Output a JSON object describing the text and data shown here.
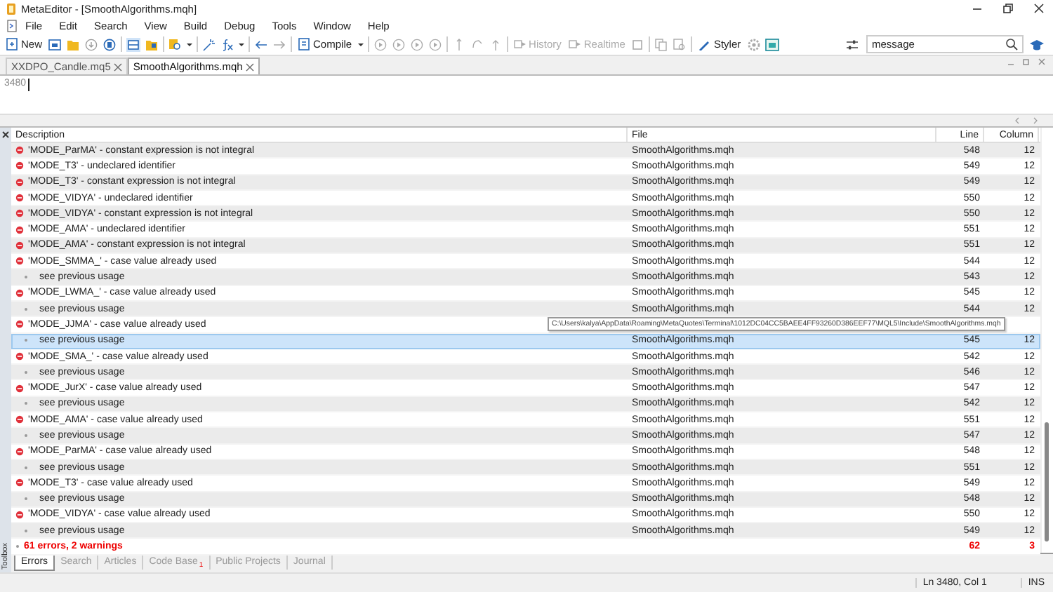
{
  "window": {
    "title": "MetaEditor - [SmoothAlgorithms.mqh]"
  },
  "menu": [
    "File",
    "Edit",
    "Search",
    "View",
    "Build",
    "Debug",
    "Tools",
    "Window",
    "Help"
  ],
  "toolbar": {
    "buttons": [
      {
        "label": "New",
        "disabled": false
      },
      {
        "label": "Compile",
        "disabled": false
      },
      {
        "label": "History",
        "disabled": true
      },
      {
        "label": "Realtime",
        "disabled": true
      },
      {
        "label": "Styler",
        "disabled": false
      }
    ],
    "search": {
      "value": "message"
    }
  },
  "tabs": [
    {
      "label": "XXDPO_Candle.mq5",
      "selected": false
    },
    {
      "label": "SmoothAlgorithms.mqh",
      "selected": true
    }
  ],
  "editor": {
    "line_number": "3480"
  },
  "errors_table": {
    "columns": [
      "Description",
      "File",
      "Line",
      "Column"
    ],
    "rows": [
      {
        "kind": "error",
        "description": "'MODE_ParMA' - constant expression is not integral",
        "file": "SmoothAlgorithms.mqh",
        "line": "548",
        "column": "12",
        "selected": false
      },
      {
        "kind": "error",
        "description": "'MODE_T3' - undeclared identifier",
        "file": "SmoothAlgorithms.mqh",
        "line": "549",
        "column": "12",
        "selected": false
      },
      {
        "kind": "error",
        "description": "'MODE_T3' - constant expression is not integral",
        "file": "SmoothAlgorithms.mqh",
        "line": "549",
        "column": "12",
        "selected": false
      },
      {
        "kind": "error",
        "description": "'MODE_VIDYA' - undeclared identifier",
        "file": "SmoothAlgorithms.mqh",
        "line": "550",
        "column": "12",
        "selected": false
      },
      {
        "kind": "error",
        "description": "'MODE_VIDYA' - constant expression is not integral",
        "file": "SmoothAlgorithms.mqh",
        "line": "550",
        "column": "12",
        "selected": false
      },
      {
        "kind": "error",
        "description": "'MODE_AMA' - undeclared identifier",
        "file": "SmoothAlgorithms.mqh",
        "line": "551",
        "column": "12",
        "selected": false
      },
      {
        "kind": "error",
        "description": "'MODE_AMA' - constant expression is not integral",
        "file": "SmoothAlgorithms.mqh",
        "line": "551",
        "column": "12",
        "selected": false
      },
      {
        "kind": "error",
        "description": "'MODE_SMMA_' - case value already used",
        "file": "SmoothAlgorithms.mqh",
        "line": "544",
        "column": "12",
        "selected": false
      },
      {
        "kind": "note",
        "description": "see previous usage",
        "file": "SmoothAlgorithms.mqh",
        "line": "543",
        "column": "12",
        "selected": false
      },
      {
        "kind": "error",
        "description": "'MODE_LWMA_' - case value already used",
        "file": "SmoothAlgorithms.mqh",
        "line": "545",
        "column": "12",
        "selected": false
      },
      {
        "kind": "note",
        "description": "see previous usage",
        "file": "SmoothAlgorithms.mqh",
        "line": "544",
        "column": "12",
        "selected": false
      },
      {
        "kind": "error",
        "description": "'MODE_JJMA' - case value already used",
        "selected": false
      },
      {
        "kind": "note",
        "description": "see previous usage",
        "file": "SmoothAlgorithms.mqh",
        "line": "545",
        "column": "12",
        "selected": true
      },
      {
        "kind": "error",
        "description": "'MODE_SMA_' - case value already used",
        "file": "SmoothAlgorithms.mqh",
        "line": "542",
        "column": "12",
        "selected": false
      },
      {
        "kind": "note",
        "description": "see previous usage",
        "file": "SmoothAlgorithms.mqh",
        "line": "546",
        "column": "12",
        "selected": false
      },
      {
        "kind": "error",
        "description": "'MODE_JurX' - case value already used",
        "file": "SmoothAlgorithms.mqh",
        "line": "547",
        "column": "12",
        "selected": false
      },
      {
        "kind": "note",
        "description": "see previous usage",
        "file": "SmoothAlgorithms.mqh",
        "line": "542",
        "column": "12",
        "selected": false
      },
      {
        "kind": "error",
        "description": "'MODE_AMA' - case value already used",
        "file": "SmoothAlgorithms.mqh",
        "line": "551",
        "column": "12",
        "selected": false
      },
      {
        "kind": "note",
        "description": "see previous usage",
        "file": "SmoothAlgorithms.mqh",
        "line": "547",
        "column": "12",
        "selected": false
      },
      {
        "kind": "error",
        "description": "'MODE_ParMA' - case value already used",
        "file": "SmoothAlgorithms.mqh",
        "line": "548",
        "column": "12",
        "selected": false
      },
      {
        "kind": "note",
        "description": "see previous usage",
        "file": "SmoothAlgorithms.mqh",
        "line": "551",
        "column": "12",
        "selected": false
      },
      {
        "kind": "error",
        "description": "'MODE_T3' - case value already used",
        "file": "SmoothAlgorithms.mqh",
        "line": "549",
        "column": "12",
        "selected": false
      },
      {
        "kind": "note",
        "description": "see previous usage",
        "file": "SmoothAlgorithms.mqh",
        "line": "548",
        "column": "12",
        "selected": false
      },
      {
        "kind": "error",
        "description": "'MODE_VIDYA' - case value already used",
        "file": "SmoothAlgorithms.mqh",
        "line": "550",
        "column": "12",
        "selected": false
      },
      {
        "kind": "note",
        "description": "see previous usage",
        "file": "SmoothAlgorithms.mqh",
        "line": "549",
        "column": "12",
        "selected": false
      }
    ],
    "summary": {
      "description": "61 errors, 2 warnings",
      "line": "62",
      "column": "3"
    }
  },
  "tooltip": "C:\\Users\\kalya\\AppData\\Roaming\\MetaQuotes\\Terminal\\1012DC04CC5BAEE4FF93260D386EEF77\\MQL5\\Include\\SmoothAlgorithms.mqh",
  "toolbox_label": "Toolbox",
  "bottom_tabs": [
    {
      "label": "Errors",
      "selected": true
    },
    {
      "label": "Search",
      "selected": false
    },
    {
      "label": "Articles",
      "selected": false
    },
    {
      "label": "Code Base",
      "selected": false,
      "badge": "1"
    },
    {
      "label": "Public Projects",
      "selected": false
    },
    {
      "label": "Journal",
      "selected": false
    }
  ],
  "status_bar": {
    "position": "Ln 3480, Col 1",
    "mode": "INS"
  }
}
